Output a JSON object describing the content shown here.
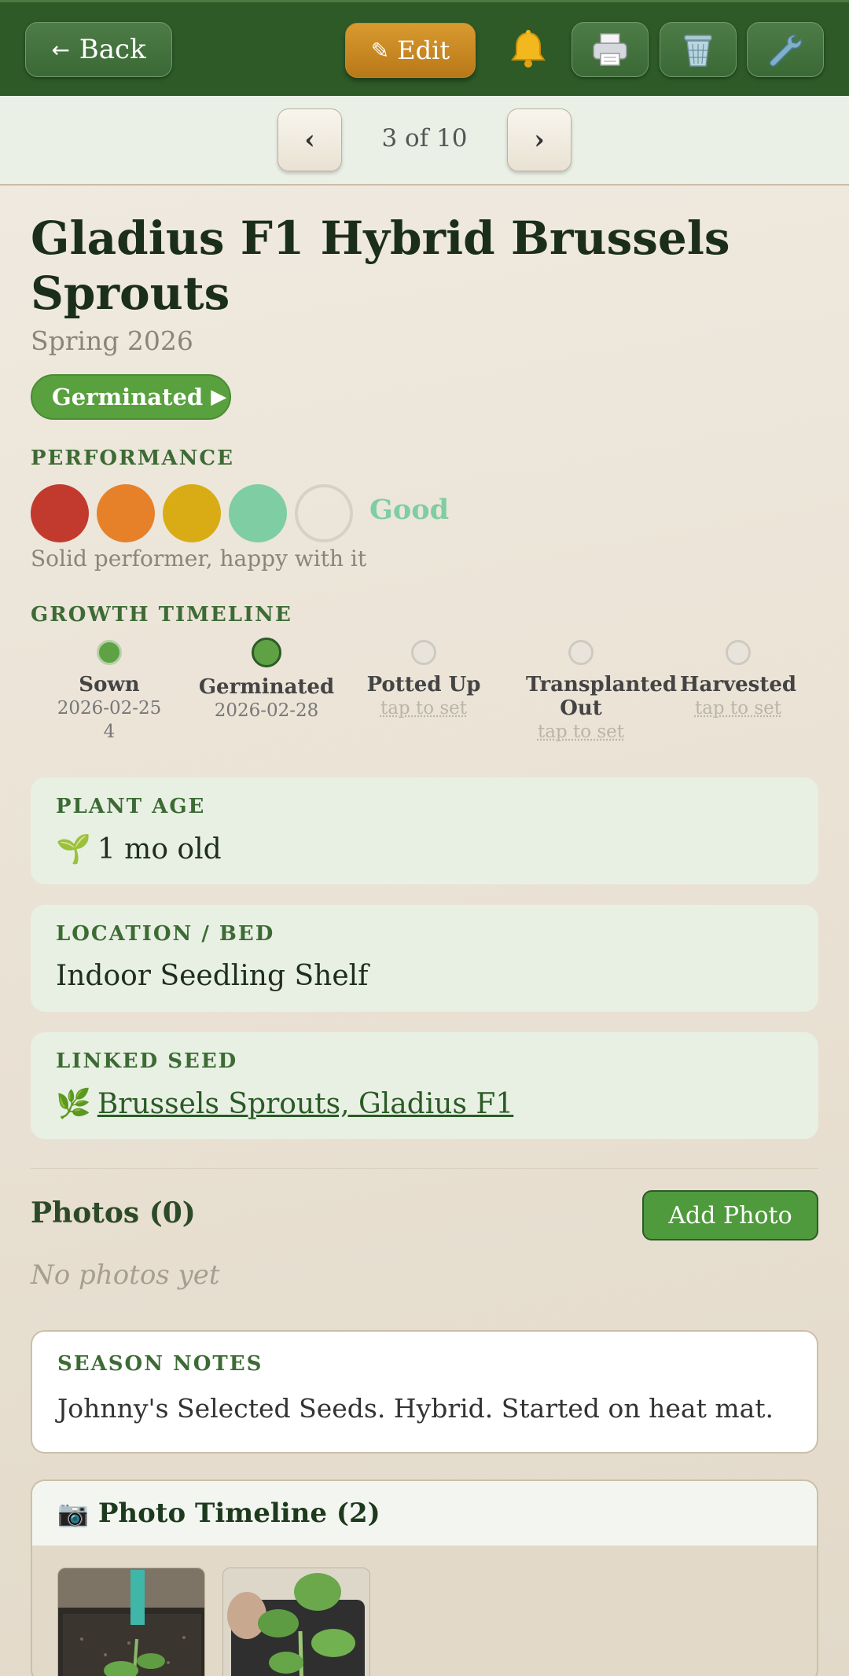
{
  "toolbar": {
    "back_label": "Back",
    "back_icon": "arrow-left-icon",
    "edit_label": "Edit",
    "edit_icon": "pencil-icon",
    "bell_icon": "bell-icon",
    "print_icon": "printer-icon",
    "trash_icon": "trash-icon",
    "settings_icon": "wrench-icon",
    "colors": {
      "bar": "#2d5a27",
      "edit": "#d99a2f"
    }
  },
  "pager": {
    "prev": "‹",
    "next": "›",
    "position": "3 of 10"
  },
  "plant": {
    "name": "Gladius F1 Hybrid Brussels Sprouts",
    "season": "Spring 2026",
    "status": "Germinated",
    "status_color": "#59a03f"
  },
  "performance": {
    "label": "PERFORMANCE",
    "rating": 4,
    "max": 5,
    "rating_label": "Good",
    "description": "Solid performer, happy with it",
    "colors": [
      "#c23a2e",
      "#e6812a",
      "#d9ac15",
      "#7fcda2"
    ]
  },
  "timeline": {
    "label": "GROWTH TIMELINE",
    "stages": [
      {
        "name": "Sown",
        "date": "2026-02-25",
        "date_extra": "4",
        "state": "done"
      },
      {
        "name": "Germinated",
        "date": "2026-02-28",
        "state": "current"
      },
      {
        "name": "Potted Up",
        "date": "tap to set",
        "state": "empty"
      },
      {
        "name": "Transplanted Out",
        "date": "tap to set",
        "state": "empty"
      },
      {
        "name": "Harvested",
        "date": "tap to set",
        "state": "empty"
      }
    ]
  },
  "cards": {
    "age_label": "PLANT AGE",
    "age_icon": "seedling-icon",
    "age_value": "1 mo old",
    "location_label": "LOCATION / BED",
    "location_value": "Indoor Seedling Shelf",
    "seed_label": "LINKED SEED",
    "seed_icon": "herb-icon",
    "seed_value": "Brussels Sprouts, Gladius F1"
  },
  "photos": {
    "heading": "Photos (0)",
    "add_label": "Add Photo",
    "empty_text": "No photos yet"
  },
  "notes": {
    "label": "SEASON NOTES",
    "text": "Johnny's Selected Seeds. Hybrid. Started on heat mat."
  },
  "photo_timeline": {
    "icon": "camera-icon",
    "heading": "Photo Timeline (2)"
  }
}
